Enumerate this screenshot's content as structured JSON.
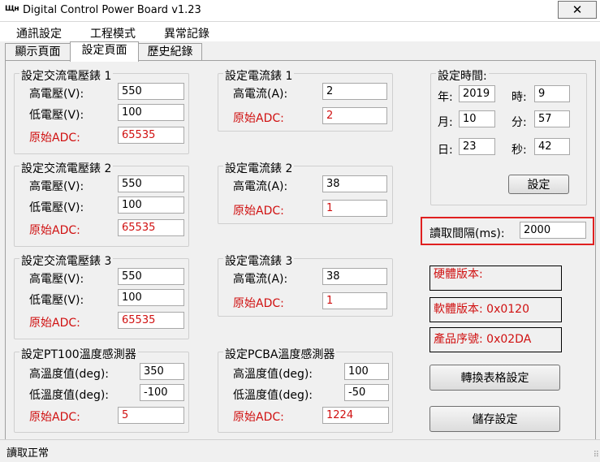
{
  "window": {
    "title": "Digital Control Power Board v1.23",
    "app_icon_text": "Щн",
    "close_glyph": "✕"
  },
  "menu": [
    "通訊設定",
    "工程模式",
    "異常記錄"
  ],
  "tabs": [
    "顯示頁面",
    "設定頁面",
    "歷史紀錄"
  ],
  "active_tab": 1,
  "ac_meters": [
    {
      "title": "設定交流電壓錶 1",
      "high_label": "高電壓(V):",
      "high": "550",
      "low_label": "低電壓(V):",
      "low": "100",
      "adc_label": "原始ADC:",
      "adc": "65535"
    },
    {
      "title": "設定交流電壓錶 2",
      "high_label": "高電壓(V):",
      "high": "550",
      "low_label": "低電壓(V):",
      "low": "100",
      "adc_label": "原始ADC:",
      "adc": "65535"
    },
    {
      "title": "設定交流電壓錶 3",
      "high_label": "高電壓(V):",
      "high": "550",
      "low_label": "低電壓(V):",
      "low": "100",
      "adc_label": "原始ADC:",
      "adc": "65535"
    }
  ],
  "current_meters": [
    {
      "title": "設定電流錶 1",
      "high_label": "高電流(A):",
      "high": "2",
      "adc_label": "原始ADC:",
      "adc": "2"
    },
    {
      "title": "設定電流錶 2",
      "high_label": "高電流(A):",
      "high": "38",
      "adc_label": "原始ADC:",
      "adc": "1"
    },
    {
      "title": "設定電流錶 3",
      "high_label": "高電流(A):",
      "high": "38",
      "adc_label": "原始ADC:",
      "adc": "1"
    }
  ],
  "pt100": {
    "title": "設定PT100溫度感測器",
    "high_label": "高溫度值(deg):",
    "high": "350",
    "low_label": "低溫度值(deg):",
    "low": "-100",
    "adc_label": "原始ADC:",
    "adc": "5"
  },
  "pcba": {
    "title": "設定PCBA溫度感測器",
    "high_label": "高溫度值(deg):",
    "high": "100",
    "low_label": "低溫度值(deg):",
    "low": "-50",
    "adc_label": "原始ADC:",
    "adc": "1224"
  },
  "time": {
    "title": "設定時間:",
    "year_label": "年:",
    "year": "2019",
    "month_label": "月:",
    "month": "10",
    "day_label": "日:",
    "day": "23",
    "hour_label": "時:",
    "hour": "9",
    "minute_label": "分:",
    "minute": "57",
    "second_label": "秒:",
    "second": "42",
    "set_button": "設定"
  },
  "read_interval": {
    "label": "讀取間隔(ms):",
    "value": "2000"
  },
  "info": {
    "hardware_version": "硬體版本:",
    "software_version": "軟體版本: 0x0120",
    "product_serial": "產品序號: 0x02DA"
  },
  "buttons": {
    "convert_table": "轉換表格設定",
    "save": "儲存設定"
  },
  "status": {
    "text": "讀取正常"
  },
  "colors": {
    "highlight_border": "#e02020",
    "adc_text": "#d01010"
  }
}
